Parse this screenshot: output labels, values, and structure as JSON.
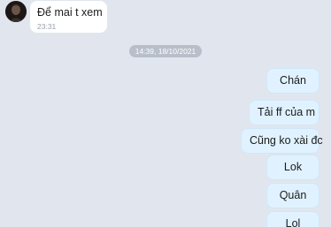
{
  "incoming_message": {
    "text": "Để mai t xem",
    "time": "23:31"
  },
  "date_separator": "14:39, 18/10/2021",
  "outgoing_messages": [
    {
      "text": "Chán"
    },
    {
      "text": "Tải ff của m"
    },
    {
      "text": "Cũng ko xài đc"
    },
    {
      "text": "Lok"
    },
    {
      "text": "Quân"
    },
    {
      "text": "Lol"
    }
  ],
  "colors": {
    "background": "#e1e6ee",
    "incoming_bubble": "#ffffff",
    "outgoing_bubble": "#e0f2ff",
    "date_pill": "#b8bfc9"
  }
}
